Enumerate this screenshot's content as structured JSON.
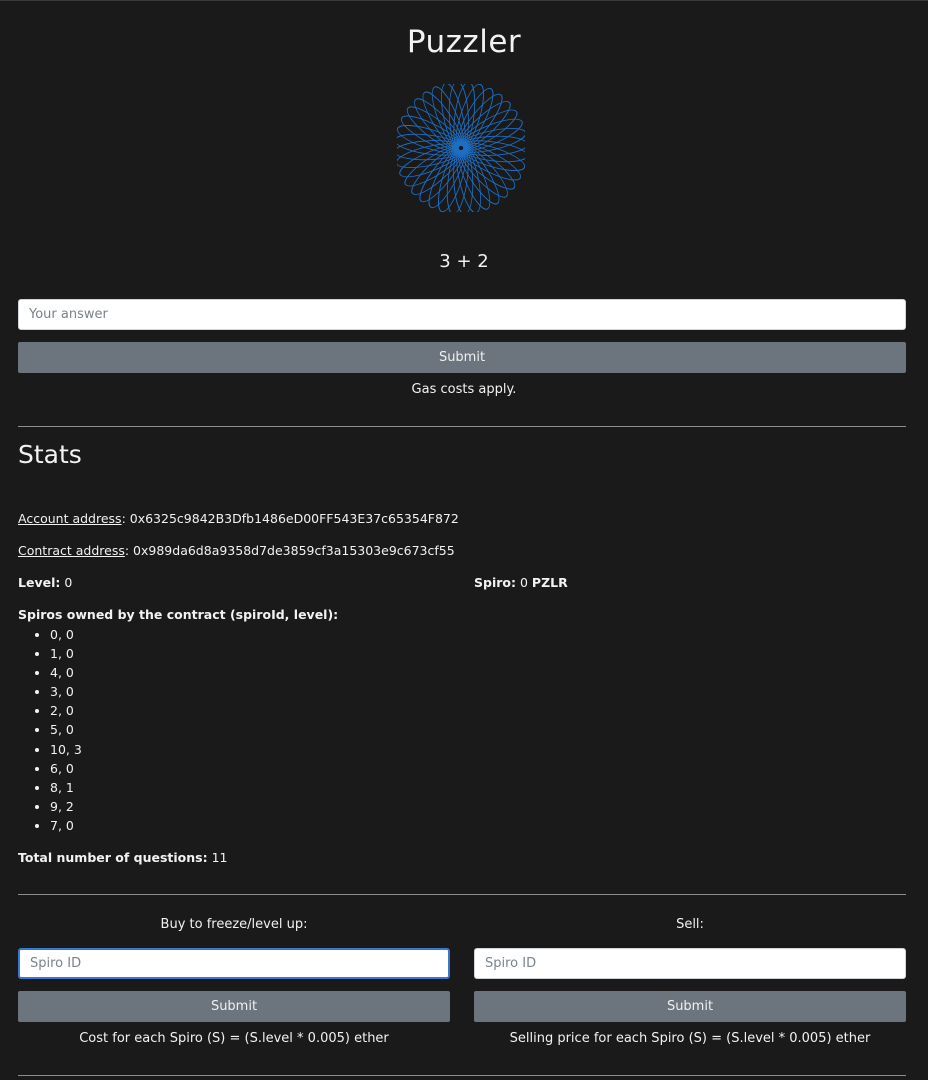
{
  "app": {
    "title": "Puzzler",
    "logo_icon": "spirograph-icon",
    "accent_color": "#1e6fc4"
  },
  "quiz": {
    "question": "3 + 2",
    "answer_placeholder": "Your answer",
    "submit_label": "Submit",
    "gas_note": "Gas costs apply."
  },
  "stats": {
    "heading": "Stats",
    "account_label": "Account address",
    "account_value": ": 0x6325c9842B3Dfb1486eD00FF543E37c65354F872",
    "contract_label": "Contract address",
    "contract_value": ": 0x989da6d8a9358d7de3859cf3a15303e9c673cf55",
    "level_label": "Level:",
    "level_value": "0",
    "spiro_label": "Spiro:",
    "spiro_value": "0",
    "spiro_unit": "PZLR",
    "owned_heading": "Spiros owned by the contract (spiroId, level):",
    "owned_items": [
      "0, 0",
      "1, 0",
      "4, 0",
      "3, 0",
      "2, 0",
      "5, 0",
      "10, 3",
      "6, 0",
      "8, 1",
      "9, 2",
      "7, 0"
    ],
    "total_label": "Total number of questions:",
    "total_value": "11"
  },
  "buy": {
    "label": "Buy to freeze/level up:",
    "placeholder": "Spiro ID",
    "submit_label": "Submit",
    "cost_note": "Cost for each Spiro (S) = (S.level * 0.005) ether"
  },
  "sell": {
    "label": "Sell:",
    "placeholder": "Spiro ID",
    "submit_label": "Submit",
    "price_note": "Selling price for each Spiro (S) = (S.level * 0.005) ether"
  }
}
